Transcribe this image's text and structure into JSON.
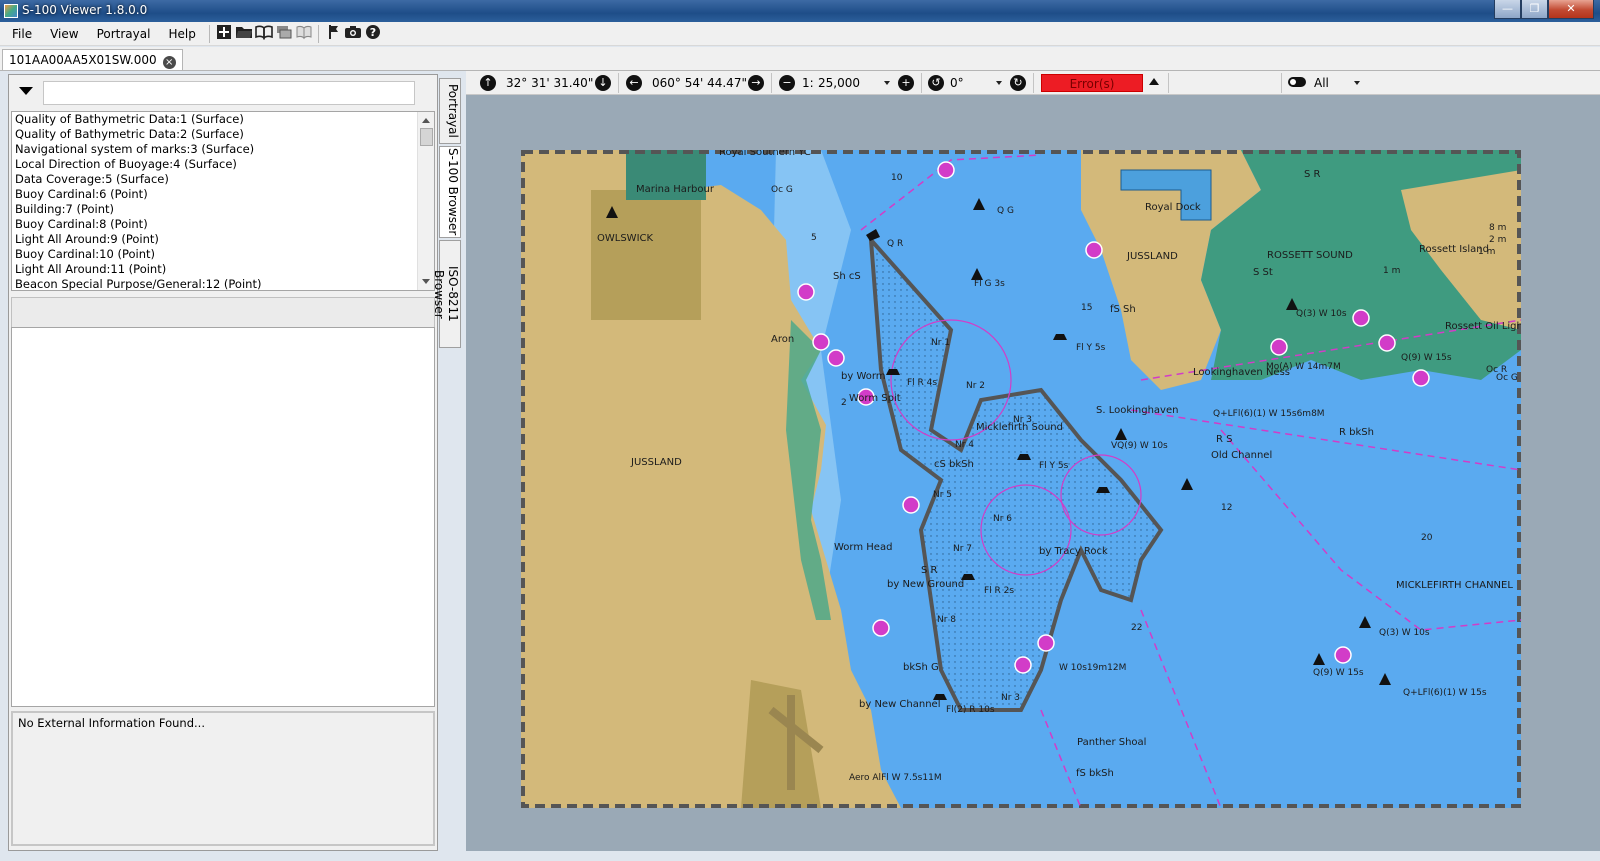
{
  "window": {
    "title": "S-100 Viewer 1.8.0.0",
    "min": "—",
    "max": "❐",
    "close": "✕"
  },
  "menu": {
    "file": "File",
    "view": "View",
    "portrayal": "Portrayal",
    "help": "Help"
  },
  "toolbar_icons": [
    "add-icon",
    "open-folder-icon",
    "catalogue-icon",
    "layers-icon",
    "book-icon",
    "flag-icon",
    "camera-icon",
    "help-icon"
  ],
  "doc_tab": {
    "label": "101AA00AA5X01SW.000",
    "close": "×"
  },
  "left": {
    "features": [
      "Quality of Bathymetric Data:1 (Surface)",
      "Quality of Bathymetric Data:2 (Surface)",
      "Navigational system of marks:3 (Surface)",
      "Local Direction of Buoyage:4 (Surface)",
      "Data Coverage:5 (Surface)",
      "Buoy Cardinal:6 (Point)",
      "Building:7 (Point)",
      "Buoy Cardinal:8 (Point)",
      "Light All Around:9 (Point)",
      "Buoy Cardinal:10 (Point)",
      "Light All Around:11 (Point)",
      "Beacon Special Purpose/General:12 (Point)"
    ],
    "external_info": "No External Information Found..."
  },
  "side_tabs": {
    "portrayal": "Portrayal",
    "s100": "S-100 Browser",
    "iso": "ISO-8211 Browser"
  },
  "chart_toolbar": {
    "latitude": "32° 31' 31.40\" S",
    "longitude": "060° 54' 44.47\" E",
    "scale_prefix": "1:",
    "scale": "25,000",
    "rotation": "0°",
    "errors": "Error(s)",
    "filter": "All"
  },
  "map_labels": {
    "owlswick": "OWLSWICK",
    "jussland_w": "JUSSLAND",
    "jussland_e": "JUSSLAND",
    "royal_dock": "Royal Dock",
    "rossett_sound": "ROSSETT SOUND",
    "rossett_island": "Rossett Island",
    "micklefirth_sound": "Micklefirth Sound",
    "micklefirth_channel": "MICKLEFIRTH CHANNEL",
    "panther_shoal": "Panther Shoal",
    "old_channel": "Old Channel",
    "lookinghaven_ness": "Lookinghaven Ness",
    "s_lookinghaven": "S. Lookinghaven",
    "worm_head": "Worm Head",
    "worm_spit": "Worm Spit",
    "by_worm": "by Worm",
    "aron": "Aron",
    "by_new_ground": "by New Ground",
    "by_new_channel": "by New Channel",
    "by_tracy_rock": "by Tracy Rock",
    "royal_southern_yc": "Royal Southern YC",
    "marina_harbour": "Marina Harbour",
    "light_fl_y_5s_a": "Fl Y 5s",
    "light_fl_y_5s_b": "Fl Y 5s",
    "light_fl_r_4s": "Fl R 4s",
    "light_fl_r_2s": "Fl R 2s",
    "light_fl_g_3s": "Fl G 3s",
    "light_fl2r_10s": "Fl(2) R 10s",
    "light_q_r": "Q R",
    "light_q_g": "Q G",
    "light_vq9": "VQ(9) W 10s",
    "light_q3": "Q(3) W 10s",
    "light_q3_e": "Q(3) W 10s",
    "light_q9": "Q(9) W 15s",
    "light_q9_e": "Q(9) W 15s",
    "light_qlfl": "Q+LFl(6)(1) W 15s",
    "light_qlfl_n": "Q+LFl(6)(1) W 15s6m8M",
    "light_oc_r": "Oc R",
    "light_oc_g": "Oc G",
    "light_mo_a": "Mo(A) W 14m7M",
    "light_w10s": "W 10s19m12M",
    "light_aero": "Aero AlFl W 7.5s11M",
    "nr1": "Nr 1",
    "nr2": "Nr 2",
    "nr3": "Nr 3",
    "nr3b": "Nr 3",
    "nr4": "Nr 4",
    "nr5": "Nr 5",
    "nr6": "Nr 6",
    "nr7": "Nr 7",
    "nr8": "Nr 8",
    "rossett_oil": "Rossett Oil Lighthouse",
    "sh_cs": "Sh cS",
    "cs_bksh": "cS bkSh",
    "fs_sh": "fS Sh",
    "fs_bksh": "fS bkSh",
    "bksh_g": "bkSh G",
    "r_bksh": "R bkSh",
    "s_r": "S R",
    "r_s": "R S",
    "s_st": "S St",
    "s_r_ne": "S R",
    "depths": [
      "10",
      "5",
      "2",
      "20",
      "22",
      "15",
      "12",
      "8 m",
      "2 m",
      "1 m",
      "1 m"
    ]
  }
}
